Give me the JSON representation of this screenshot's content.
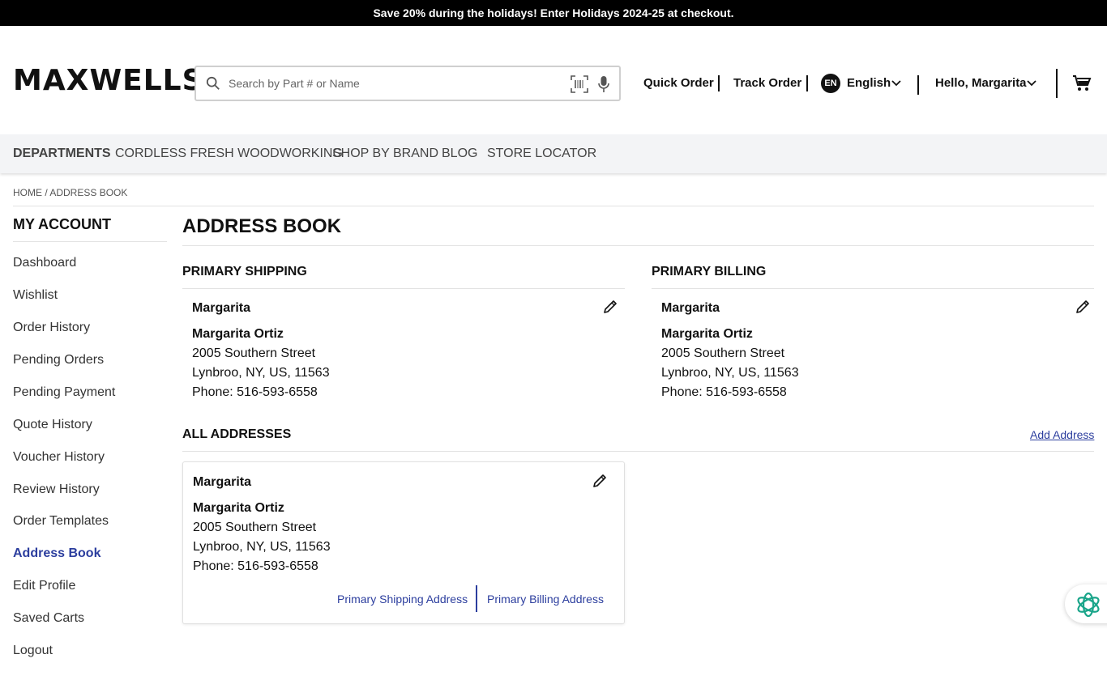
{
  "promo": {
    "text": "Save 20% during the holidays! Enter Holidays 2024-25 at checkout."
  },
  "header": {
    "logo": "MAXWELLS",
    "search_placeholder": "Search by Part # or Name",
    "quick_order": "Quick Order",
    "track_order": "Track Order",
    "lang_code": "EN",
    "language": "English",
    "greeting": "Hello, Margarita"
  },
  "nav": {
    "items": [
      "DEPARTMENTS",
      "CORDLESS FRESH WOODWORKING",
      "SHOP BY BRAND",
      "BLOG",
      "STORE LOCATOR"
    ]
  },
  "breadcrumb": "HOME / ADDRESS BOOK",
  "sidebar": {
    "title": "MY ACCOUNT",
    "items": [
      "Dashboard",
      "Wishlist",
      "Order History",
      "Pending Orders",
      "Pending Payment",
      "Quote History",
      "Voucher History",
      "Review History",
      "Order Templates",
      "Address Book",
      "Edit Profile",
      "Saved Carts",
      "Logout"
    ],
    "active": "Address Book"
  },
  "main": {
    "title": "ADDRESS BOOK",
    "primary_shipping": {
      "heading": "PRIMARY SHIPPING",
      "nickname": "Margarita",
      "full_name": "Margarita Ortiz",
      "street": "2005 Southern Street",
      "city_line": "Lynbroo, NY, US, 11563",
      "phone": "Phone: 516-593-6558"
    },
    "primary_billing": {
      "heading": "PRIMARY BILLING",
      "nickname": "Margarita",
      "full_name": "Margarita Ortiz",
      "street": "2005 Southern Street",
      "city_line": "Lynbroo, NY, US, 11563",
      "phone": "Phone: 516-593-6558"
    },
    "all_addresses": {
      "heading": "ALL ADDRESSES",
      "add_link": "Add Address",
      "cards": [
        {
          "nickname": "Margarita",
          "full_name": "Margarita Ortiz",
          "street": "2005 Southern Street",
          "city_line": "Lynbroo, NY, US, 11563",
          "phone": "Phone: 516-593-6558",
          "set_shipping": "Primary Shipping Address",
          "set_billing": "Primary Billing Address"
        }
      ]
    }
  },
  "colors": {
    "accent": "#2c3e9e",
    "promo_bg": "#000000",
    "nav_bg": "#f3f4f6",
    "chat_icon": "#1aa58a"
  }
}
